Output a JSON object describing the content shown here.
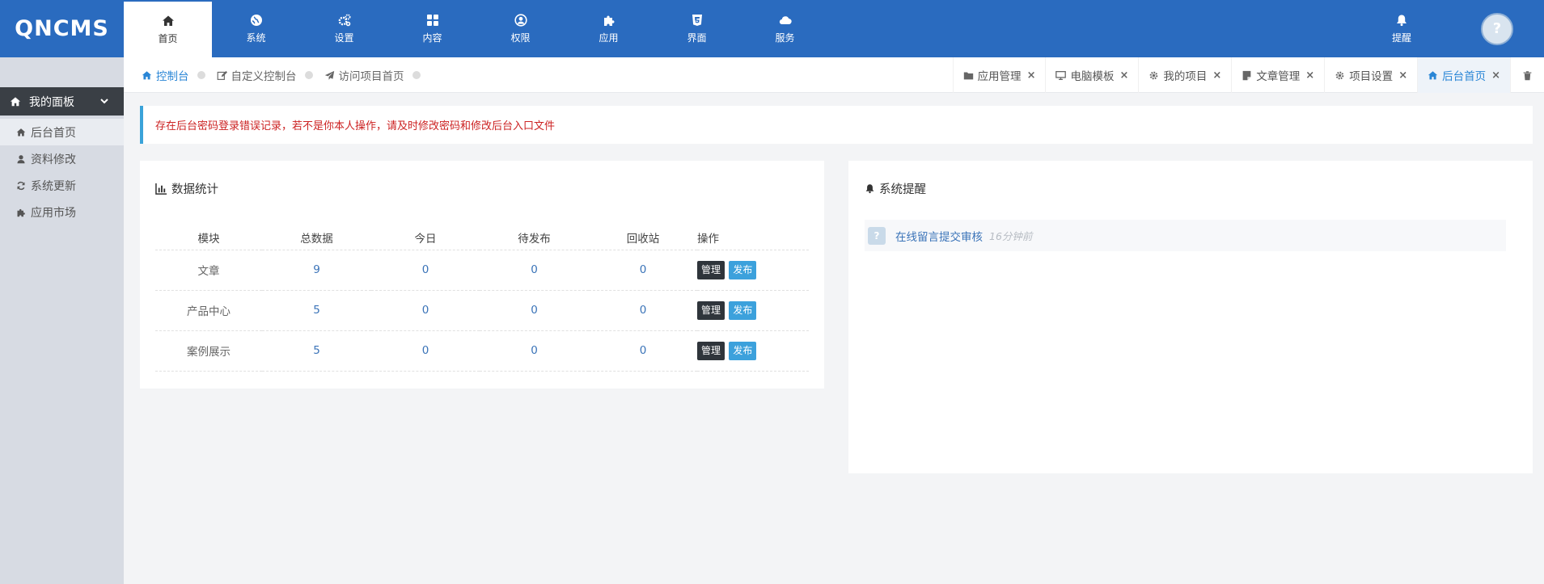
{
  "brand": {
    "logo": "QNCMS"
  },
  "topnav": [
    {
      "label": "首页",
      "icon": "home-icon",
      "active": true
    },
    {
      "label": "系统",
      "icon": "globe-icon"
    },
    {
      "label": "设置",
      "icon": "cogs-icon"
    },
    {
      "label": "内容",
      "icon": "grid-icon"
    },
    {
      "label": "权限",
      "icon": "user-circle-icon"
    },
    {
      "label": "应用",
      "icon": "puzzle-icon"
    },
    {
      "label": "界面",
      "icon": "html5-icon"
    },
    {
      "label": "服务",
      "icon": "cloud-icon"
    }
  ],
  "top_right": {
    "bell_label": "提醒",
    "avatar_text": "?"
  },
  "sidebar": {
    "panel_title": "我的面板",
    "items": [
      {
        "label": "后台首页",
        "icon": "home-icon",
        "active": true
      },
      {
        "label": "资料修改",
        "icon": "user-icon"
      },
      {
        "label": "系统更新",
        "icon": "refresh-icon"
      },
      {
        "label": "应用市场",
        "icon": "puzzle-icon"
      }
    ]
  },
  "crumbs": [
    {
      "label": "控制台",
      "icon": "home-icon",
      "active": true
    },
    {
      "label": "自定义控制台",
      "icon": "edit-icon"
    },
    {
      "label": "访问项目首页",
      "icon": "send-icon"
    }
  ],
  "tabs": [
    {
      "label": "应用管理",
      "icon": "folder-icon"
    },
    {
      "label": "电脑模板",
      "icon": "desktop-icon"
    },
    {
      "label": "我的项目",
      "icon": "gear-icon"
    },
    {
      "label": "文章管理",
      "icon": "file-icon"
    },
    {
      "label": "项目设置",
      "icon": "gear-icon"
    },
    {
      "label": "后台首页",
      "icon": "home-icon",
      "active": true
    }
  ],
  "tab_close": "×",
  "alert": {
    "text": "存在后台密码登录错误记录，若不是你本人操作，请及时修改密码和修改后台入口文件"
  },
  "stats": {
    "title": "数据统计",
    "headers": [
      "模块",
      "总数据",
      "今日",
      "待发布",
      "回收站",
      "操作"
    ],
    "rows": [
      {
        "module": "文章",
        "total": "9",
        "today": "0",
        "pending": "0",
        "recycle": "0"
      },
      {
        "module": "产品中心",
        "total": "5",
        "today": "0",
        "pending": "0",
        "recycle": "0"
      },
      {
        "module": "案例展示",
        "total": "5",
        "today": "0",
        "pending": "0",
        "recycle": "0"
      }
    ],
    "manage_label": "管理",
    "publish_label": "发布"
  },
  "notice": {
    "title": "系统提醒",
    "items": [
      {
        "text": "在线留言提交审核",
        "time": "16分钟前",
        "icon_text": "?"
      }
    ]
  },
  "colors": {
    "primary": "#2a6bbf",
    "accent": "#3ca1dc",
    "alert": "#cc2222",
    "dark_button": "#2f353b"
  }
}
